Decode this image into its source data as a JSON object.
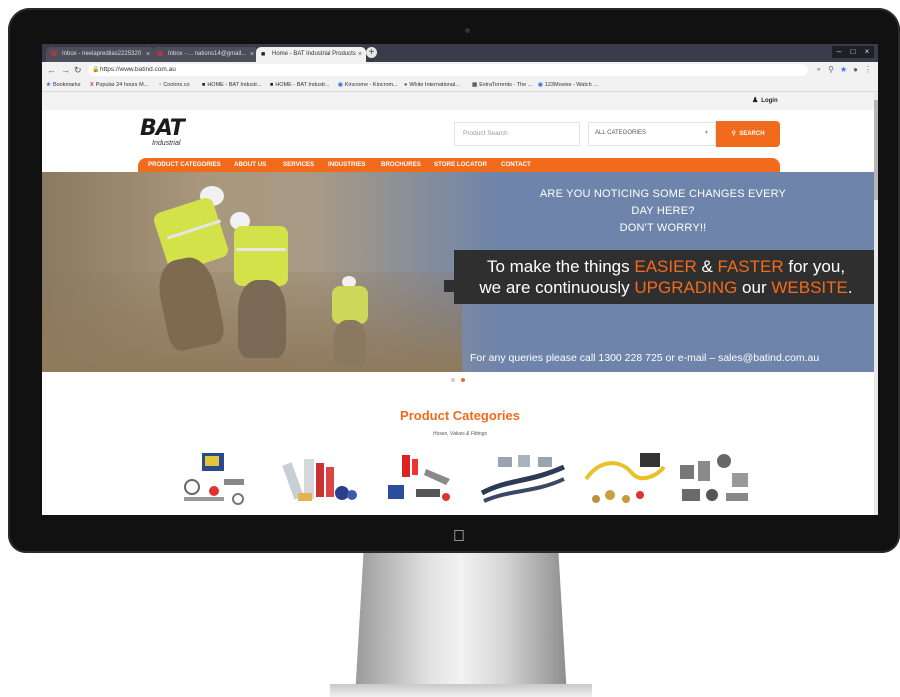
{
  "browser": {
    "tabs": [
      {
        "label": "Inbox - neelapredilas2225320",
        "icon": "gmail-icon"
      },
      {
        "label": "Inbox - ... nations14@gmail...",
        "icon": "gmail-icon"
      },
      {
        "label": "Home - BAT Industrial Products",
        "icon": "bat-icon"
      }
    ],
    "url": "https://www.batind.com.au",
    "bookmarks": [
      "Bookmarks",
      "Popular 24 hours M...",
      "Coolors.co",
      "HOME - BAT Industr...",
      "HOME - BAT Industr...",
      "Kincrome - Kincrom...",
      "White International...",
      "ExtraTorrents - The ...",
      "123Movies - Watch ..."
    ]
  },
  "header": {
    "login_label": "Login",
    "logo_text": "BAT",
    "logo_sub": "Industrial",
    "search_placeholder": "Product Search",
    "category_value": "ALL CATEGORIES",
    "search_button": "SEARCH"
  },
  "nav": {
    "items": [
      "PRODUCT CATEGORIES",
      "ABOUT US",
      "SERVICES",
      "INDUSTRIES",
      "BROCHURES",
      "STORE LOCATOR",
      "CONTACT"
    ]
  },
  "hero": {
    "question_line1": "ARE YOU NOTICING SOME CHANGES EVERY DAY HERE?",
    "question_line2": "DON'T WORRY!!",
    "line1_a": "To make the things ",
    "line1_b": "EASIER",
    "line1_c": " & ",
    "line1_d": "FASTER",
    "line1_e": " for you,",
    "line2_a": "we are continuously ",
    "line2_b": "UPGRADING",
    "line2_c": " our ",
    "line2_d": "WEBSITE",
    "line2_e": ".",
    "contact": "For any queries please call 1300 228 725 or e-mail – sales@batind.com.au",
    "accent": "#f26b1d"
  },
  "slider": {
    "active_index": 1,
    "count": 2
  },
  "products": {
    "title": "Product Categories",
    "subtitle": "Hoses, Valves & Fittings"
  }
}
